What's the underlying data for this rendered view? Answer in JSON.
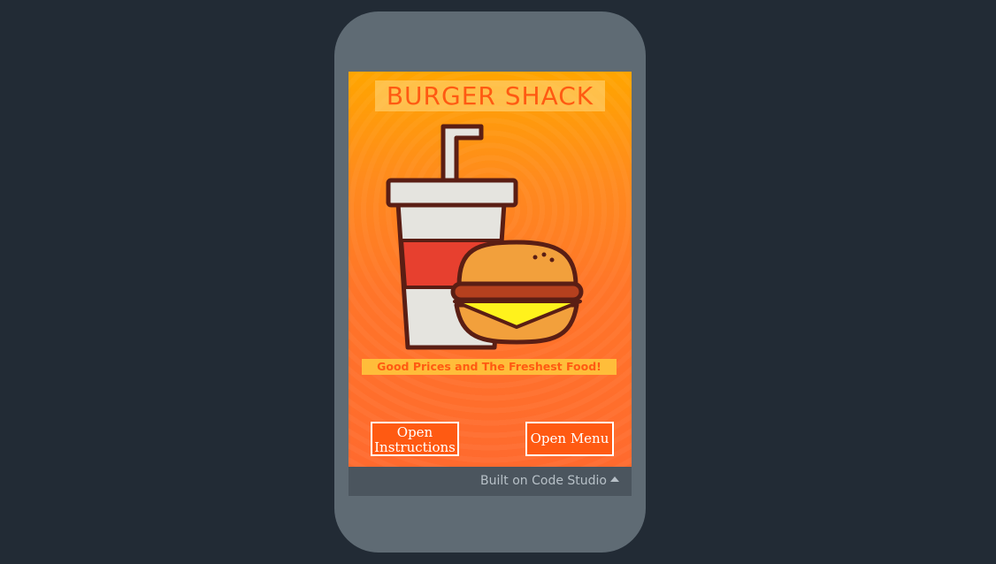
{
  "app": {
    "title": "BURGER SHACK",
    "tagline": "Good Prices and The Freshest Food!",
    "image": "burger-and-drink-illustration"
  },
  "buttons": {
    "instructions_label": "Open Instructions",
    "menu_label": "Open Menu"
  },
  "footer": {
    "text": "Built on Code Studio",
    "icon": "caret-up-icon"
  },
  "colors": {
    "accent": "#ff5a12",
    "background_top": "#ffa500",
    "background_bottom": "#ff6a2e",
    "title_bg": "#ffd678",
    "tagline_bg": "#ffbd3a",
    "page_bg": "#222b35",
    "device": "#5f6b74",
    "footer_bg": "#4b555e"
  }
}
